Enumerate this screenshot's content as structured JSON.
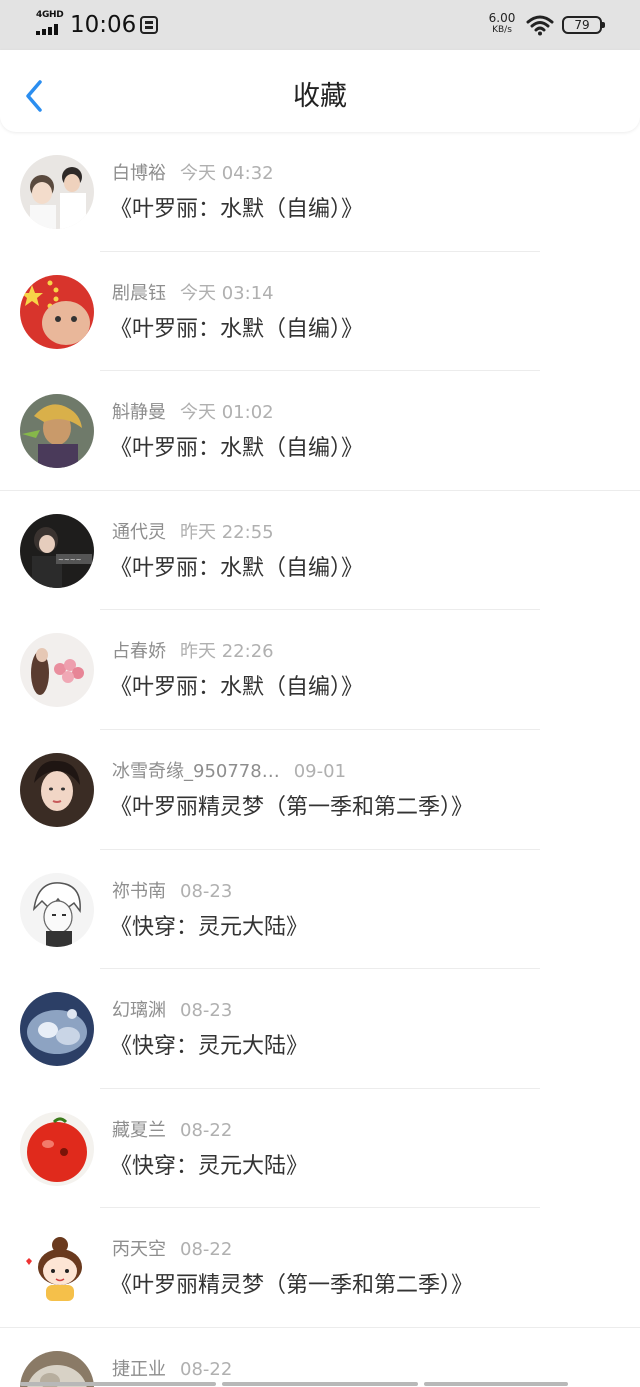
{
  "status_bar": {
    "network": "4GHD",
    "time": "10:06",
    "speed_value": "6.00",
    "speed_unit": "KB/s",
    "battery": "79"
  },
  "header": {
    "title": "收藏",
    "back_icon": "chevron-left-icon",
    "accent": "#2b8ef0"
  },
  "items": [
    {
      "user": "白博裕",
      "time": "今天 04:32",
      "title": "《叶罗丽：水默（自编）》"
    },
    {
      "user": "剧晨钰",
      "time": "今天 03:14",
      "title": "《叶罗丽：水默（自编）》"
    },
    {
      "user": "斛静曼",
      "time": "今天 01:02",
      "title": "《叶罗丽：水默（自编）》"
    },
    {
      "user": "通代灵",
      "time": "昨天 22:55",
      "title": "《叶罗丽：水默（自编）》"
    },
    {
      "user": "占春娇",
      "time": "昨天 22:26",
      "title": "《叶罗丽：水默（自编）》"
    },
    {
      "user": "冰雪奇缘_950778…",
      "time": "09-01",
      "title": "《叶罗丽精灵梦（第一季和第二季）》"
    },
    {
      "user": "祢书南",
      "time": "08-23",
      "title": "《快穿：灵元大陆》"
    },
    {
      "user": "幻璃渊",
      "time": "08-23",
      "title": "《快穿：灵元大陆》"
    },
    {
      "user": "藏夏兰",
      "time": "08-22",
      "title": "《快穿：灵元大陆》"
    },
    {
      "user": "丙天空",
      "time": "08-22",
      "title": "《叶罗丽精灵梦（第一季和第二季）》"
    },
    {
      "user": "捷正业",
      "time": "08-22",
      "title": ""
    }
  ]
}
